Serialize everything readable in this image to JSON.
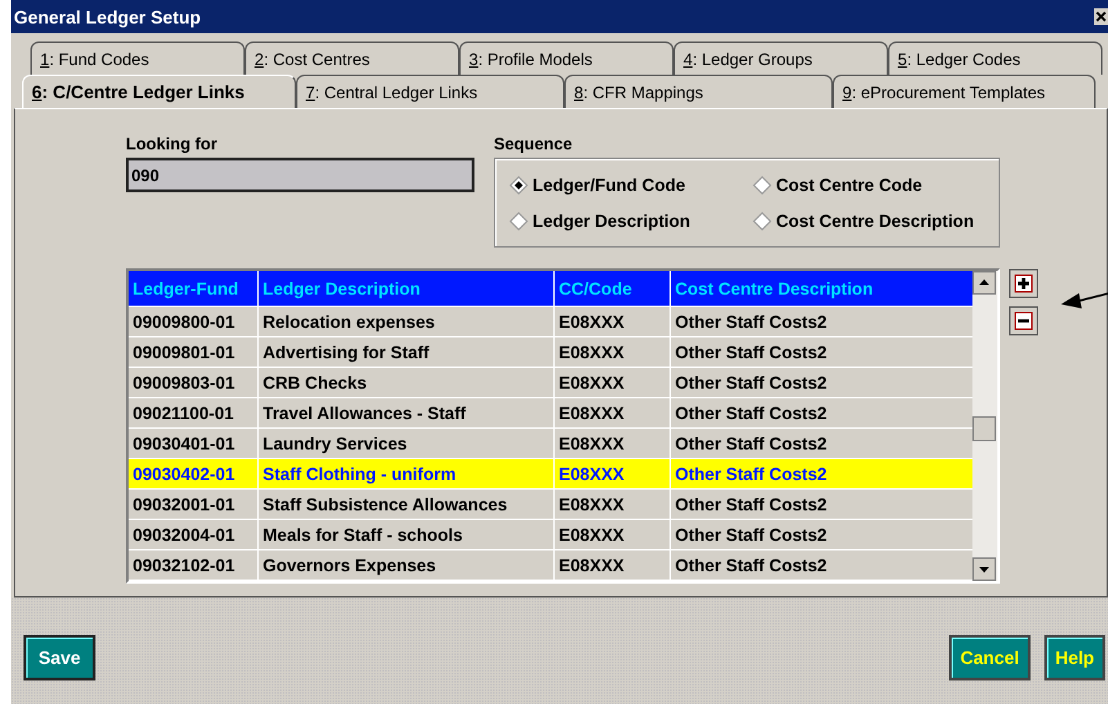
{
  "window": {
    "title": "General Ledger Setup"
  },
  "tab_rows": [
    [
      {
        "key": "1",
        "label": ": Fund Codes",
        "selected": false
      },
      {
        "key": "2",
        "label": ": Cost Centres",
        "selected": false
      },
      {
        "key": "3",
        "label": ": Profile Models",
        "selected": false
      },
      {
        "key": "4",
        "label": ": Ledger Groups",
        "selected": false
      },
      {
        "key": "5",
        "label": ": Ledger Codes",
        "selected": false
      }
    ],
    [
      {
        "key": "6",
        "label": ": C/Centre Ledger Links",
        "selected": true
      },
      {
        "key": "7",
        "label": ": Central Ledger Links",
        "selected": false
      },
      {
        "key": "8",
        "label": ": CFR Mappings",
        "selected": false
      },
      {
        "key": "9",
        "label": ": eProcurement Templates",
        "selected": false
      }
    ]
  ],
  "search": {
    "label": "Looking for",
    "value": "090"
  },
  "sequence": {
    "label": "Sequence",
    "options": [
      {
        "label": "Ledger/Fund Code",
        "selected": true
      },
      {
        "label": "Cost Centre Code",
        "selected": false
      },
      {
        "label": "Ledger Description",
        "selected": false
      },
      {
        "label": "Cost Centre Description",
        "selected": false
      }
    ]
  },
  "table": {
    "columns": [
      "Ledger-Fund",
      "Ledger Description",
      "CC/Code",
      "Cost Centre Description"
    ],
    "rows": [
      {
        "cells": [
          "09009800-01",
          "Relocation expenses",
          "E08XXX",
          "Other Staff Costs2"
        ],
        "selected": false
      },
      {
        "cells": [
          "09009801-01",
          "Advertising for Staff",
          "E08XXX",
          "Other Staff Costs2"
        ],
        "selected": false
      },
      {
        "cells": [
          "09009803-01",
          "CRB Checks",
          "E08XXX",
          "Other Staff Costs2"
        ],
        "selected": false
      },
      {
        "cells": [
          "09021100-01",
          "Travel Allowances - Staff",
          "E08XXX",
          "Other Staff Costs2"
        ],
        "selected": false
      },
      {
        "cells": [
          "09030401-01",
          "Laundry Services",
          "E08XXX",
          "Other Staff Costs2"
        ],
        "selected": false
      },
      {
        "cells": [
          "09030402-01",
          "Staff Clothing - uniform",
          "E08XXX",
          "Other Staff Costs2"
        ],
        "selected": true
      },
      {
        "cells": [
          "09032001-01",
          "Staff Subsistence Allowances",
          "E08XXX",
          "Other Staff Costs2"
        ],
        "selected": false
      },
      {
        "cells": [
          "09032004-01",
          "Meals for Staff - schools",
          "E08XXX",
          "Other Staff Costs2"
        ],
        "selected": false
      },
      {
        "cells": [
          "09032102-01",
          "Governors Expenses",
          "E08XXX",
          "Other Staff Costs2"
        ],
        "selected": false
      }
    ]
  },
  "buttons_left": [
    "Save"
  ],
  "buttons_right": [
    "Cancel",
    "Help"
  ]
}
